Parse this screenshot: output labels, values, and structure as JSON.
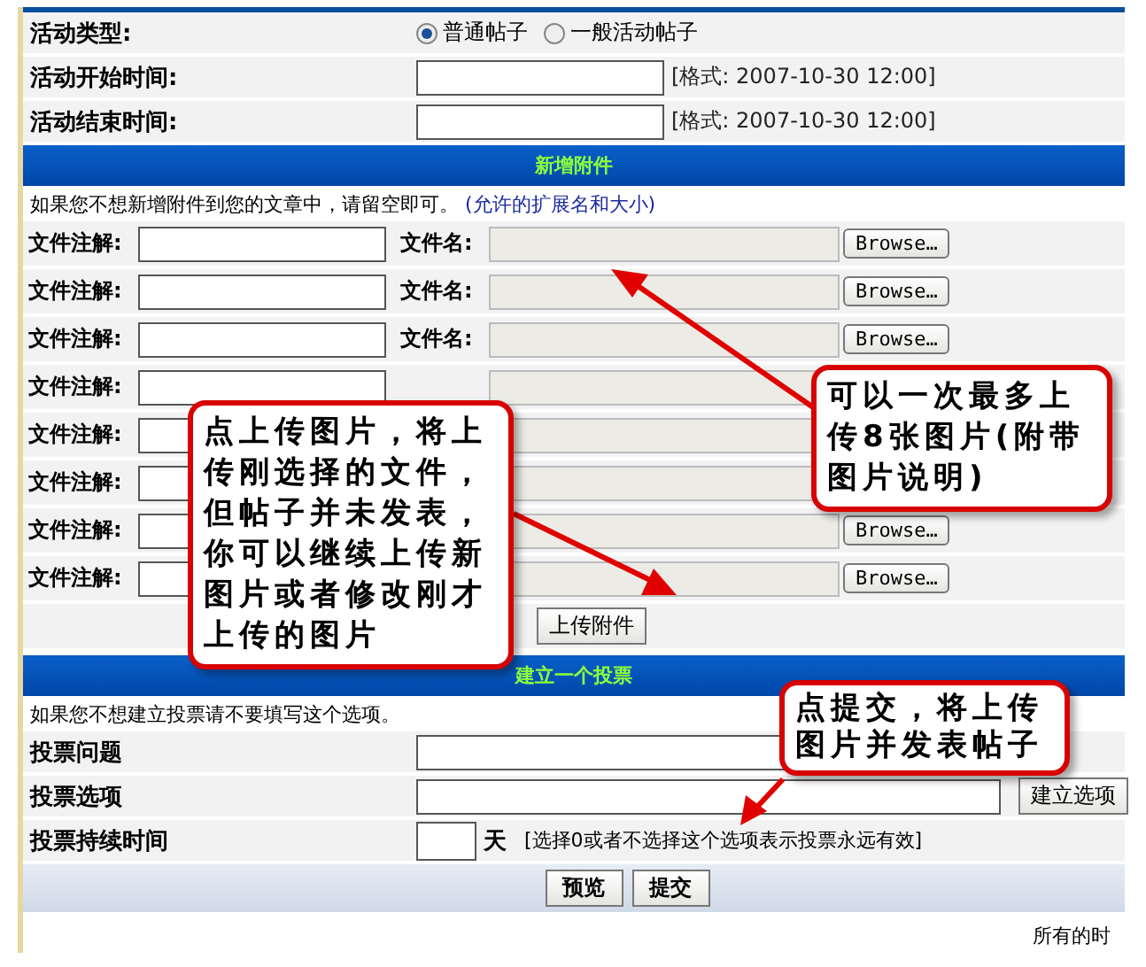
{
  "activity": {
    "type_label": "活动类型:",
    "options": [
      {
        "label": "普通帖子",
        "selected": true
      },
      {
        "label": "一般活动帖子",
        "selected": false
      }
    ],
    "fields": [
      {
        "label": "活动开始时间:",
        "hint": "[格式: 2007-10-30 12:00]"
      },
      {
        "label": "活动结束时间:",
        "hint": "[格式: 2007-10-30 12:00]"
      }
    ]
  },
  "attachments": {
    "title": "新增附件",
    "note": "如果您不想新增附件到您的文章中，请留空即可。",
    "note_link": "(允许的扩展名和大小)",
    "rows": [
      {
        "note_label": "文件注解:",
        "name_label": "文件名:",
        "browse": "Browse…"
      },
      {
        "note_label": "文件注解:",
        "name_label": "文件名:",
        "browse": "Browse…"
      },
      {
        "note_label": "文件注解:",
        "name_label": "文件名:",
        "browse": "Browse…"
      },
      {
        "note_label": "文件注解:"
      },
      {
        "note_label": "文件注解:"
      },
      {
        "note_label": "文件注解:"
      },
      {
        "note_label": "文件注解:",
        "browse": "Browse…"
      },
      {
        "note_label": "文件注解:",
        "browse": "Browse…"
      }
    ],
    "upload_button": "上传附件"
  },
  "poll": {
    "title": "建立一个投票",
    "note": "如果您不想建立投票请不要填写这个选项。",
    "question_label": "投票问题",
    "options_label": "投票选项",
    "add_option_button": "建立选项",
    "duration_label": "投票持续时间",
    "duration_unit": "天",
    "duration_hint": "[选择0或者不选择这个选项表示投票永远有效]"
  },
  "buttons": [
    "预览",
    "提交"
  ],
  "footer": "所有的时",
  "callouts": [
    {
      "text": "点上传图片，将上传刚选择的文件，但帖子并未发表，你可以继续上传新图片或者修改刚才上传的图片",
      "kind": "left"
    },
    {
      "text": "可以一次最多上传8张图片(附带图片说明)",
      "kind": "right"
    },
    {
      "text": "点提交，将上传图片并发表帖子",
      "kind": "bottom"
    }
  ]
}
